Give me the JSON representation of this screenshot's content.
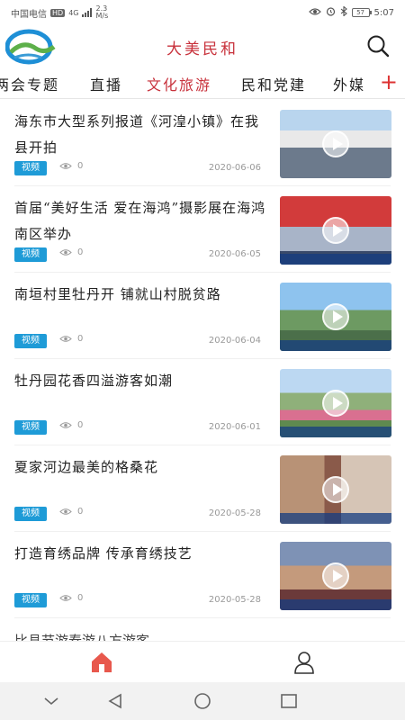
{
  "status_bar": {
    "carrier": "中国电信",
    "network_badge": "HD",
    "network_type": "4G",
    "speed": "2.3 M/s",
    "battery": "57",
    "time": "5:07"
  },
  "header": {
    "app_title": "大美民和",
    "search_icon": "search-icon",
    "logo_icon": "logo-icon"
  },
  "tabs": {
    "items": [
      {
        "label": "两会专题"
      },
      {
        "label": "直播"
      },
      {
        "label": "文化旅游"
      },
      {
        "label": "民和党建"
      },
      {
        "label": "外媒"
      }
    ],
    "active_index": 2,
    "more_label": "+"
  },
  "news": [
    {
      "title": "海东市大型系列报道《河湟小镇》在我县开拍",
      "tag": "视频",
      "views": "0",
      "date": "2020-06-06"
    },
    {
      "title": "首届“美好生活 爱在海鸿”摄影展在海鸿南区举办",
      "tag": "视频",
      "views": "0",
      "date": "2020-06-05"
    },
    {
      "title": "南垣村里牡丹开 铺就山村脱贫路",
      "tag": "视频",
      "views": "0",
      "date": "2020-06-04"
    },
    {
      "title": "牡丹园花香四溢游客如潮",
      "tag": "视频",
      "views": "0",
      "date": "2020-06-01"
    },
    {
      "title": "夏家河边最美的格桑花",
      "tag": "视频",
      "views": "0",
      "date": "2020-05-28"
    },
    {
      "title": "打造育绣品牌 传承育绣技艺",
      "tag": "视频",
      "views": "0",
      "date": "2020-05-28"
    }
  ],
  "partial_next_title": "比县节游春游八方游客",
  "bottom_nav": {
    "home_icon": "home-icon",
    "user_icon": "user-icon",
    "active_color": "#e8584d"
  },
  "system_nav": {
    "icons": [
      "chevron-down-icon",
      "back-icon",
      "home-circle-icon",
      "recents-icon"
    ]
  },
  "colors": {
    "accent_red": "#c8323c",
    "tag_blue": "#1e9bd7"
  }
}
